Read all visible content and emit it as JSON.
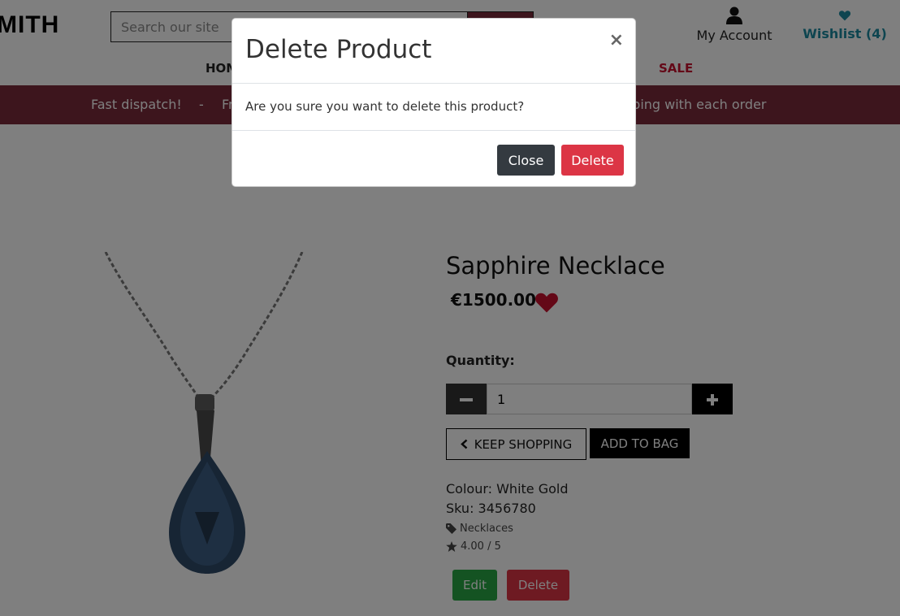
{
  "header": {
    "logo": "MITH",
    "search_placeholder": "Search our site",
    "account_label": "My Account",
    "wishlist_label": "Wishlist (4)"
  },
  "nav": {
    "home": "HOM",
    "sale": "SALE"
  },
  "banner": {
    "item1": "Fast dispatch!",
    "sep": "-",
    "item2": "Fr",
    "item3": "pping with each order"
  },
  "product": {
    "title": "Sapphire Necklace",
    "price": "€1500.00",
    "quantity_label": "Quantity:",
    "quantity_value": "1",
    "keep_shopping": "KEEP SHOPPING",
    "add_to_bag": "ADD TO BAG",
    "colour": "Colour: White Gold",
    "sku": "Sku: 3456780",
    "category": "Necklaces",
    "rating": "4.00 / 5",
    "edit_label": "Edit",
    "delete_label": "Delete"
  },
  "modal": {
    "title": "Delete Product",
    "close_icon": "×",
    "body": "Are you sure you want to delete this product?",
    "close_label": "Close",
    "delete_label": "Delete"
  },
  "colors": {
    "brand": "#7a2a3b",
    "wishlist": "#1c8aa0",
    "danger": "#dc3545",
    "success": "#28a745",
    "dark": "#343a40"
  }
}
